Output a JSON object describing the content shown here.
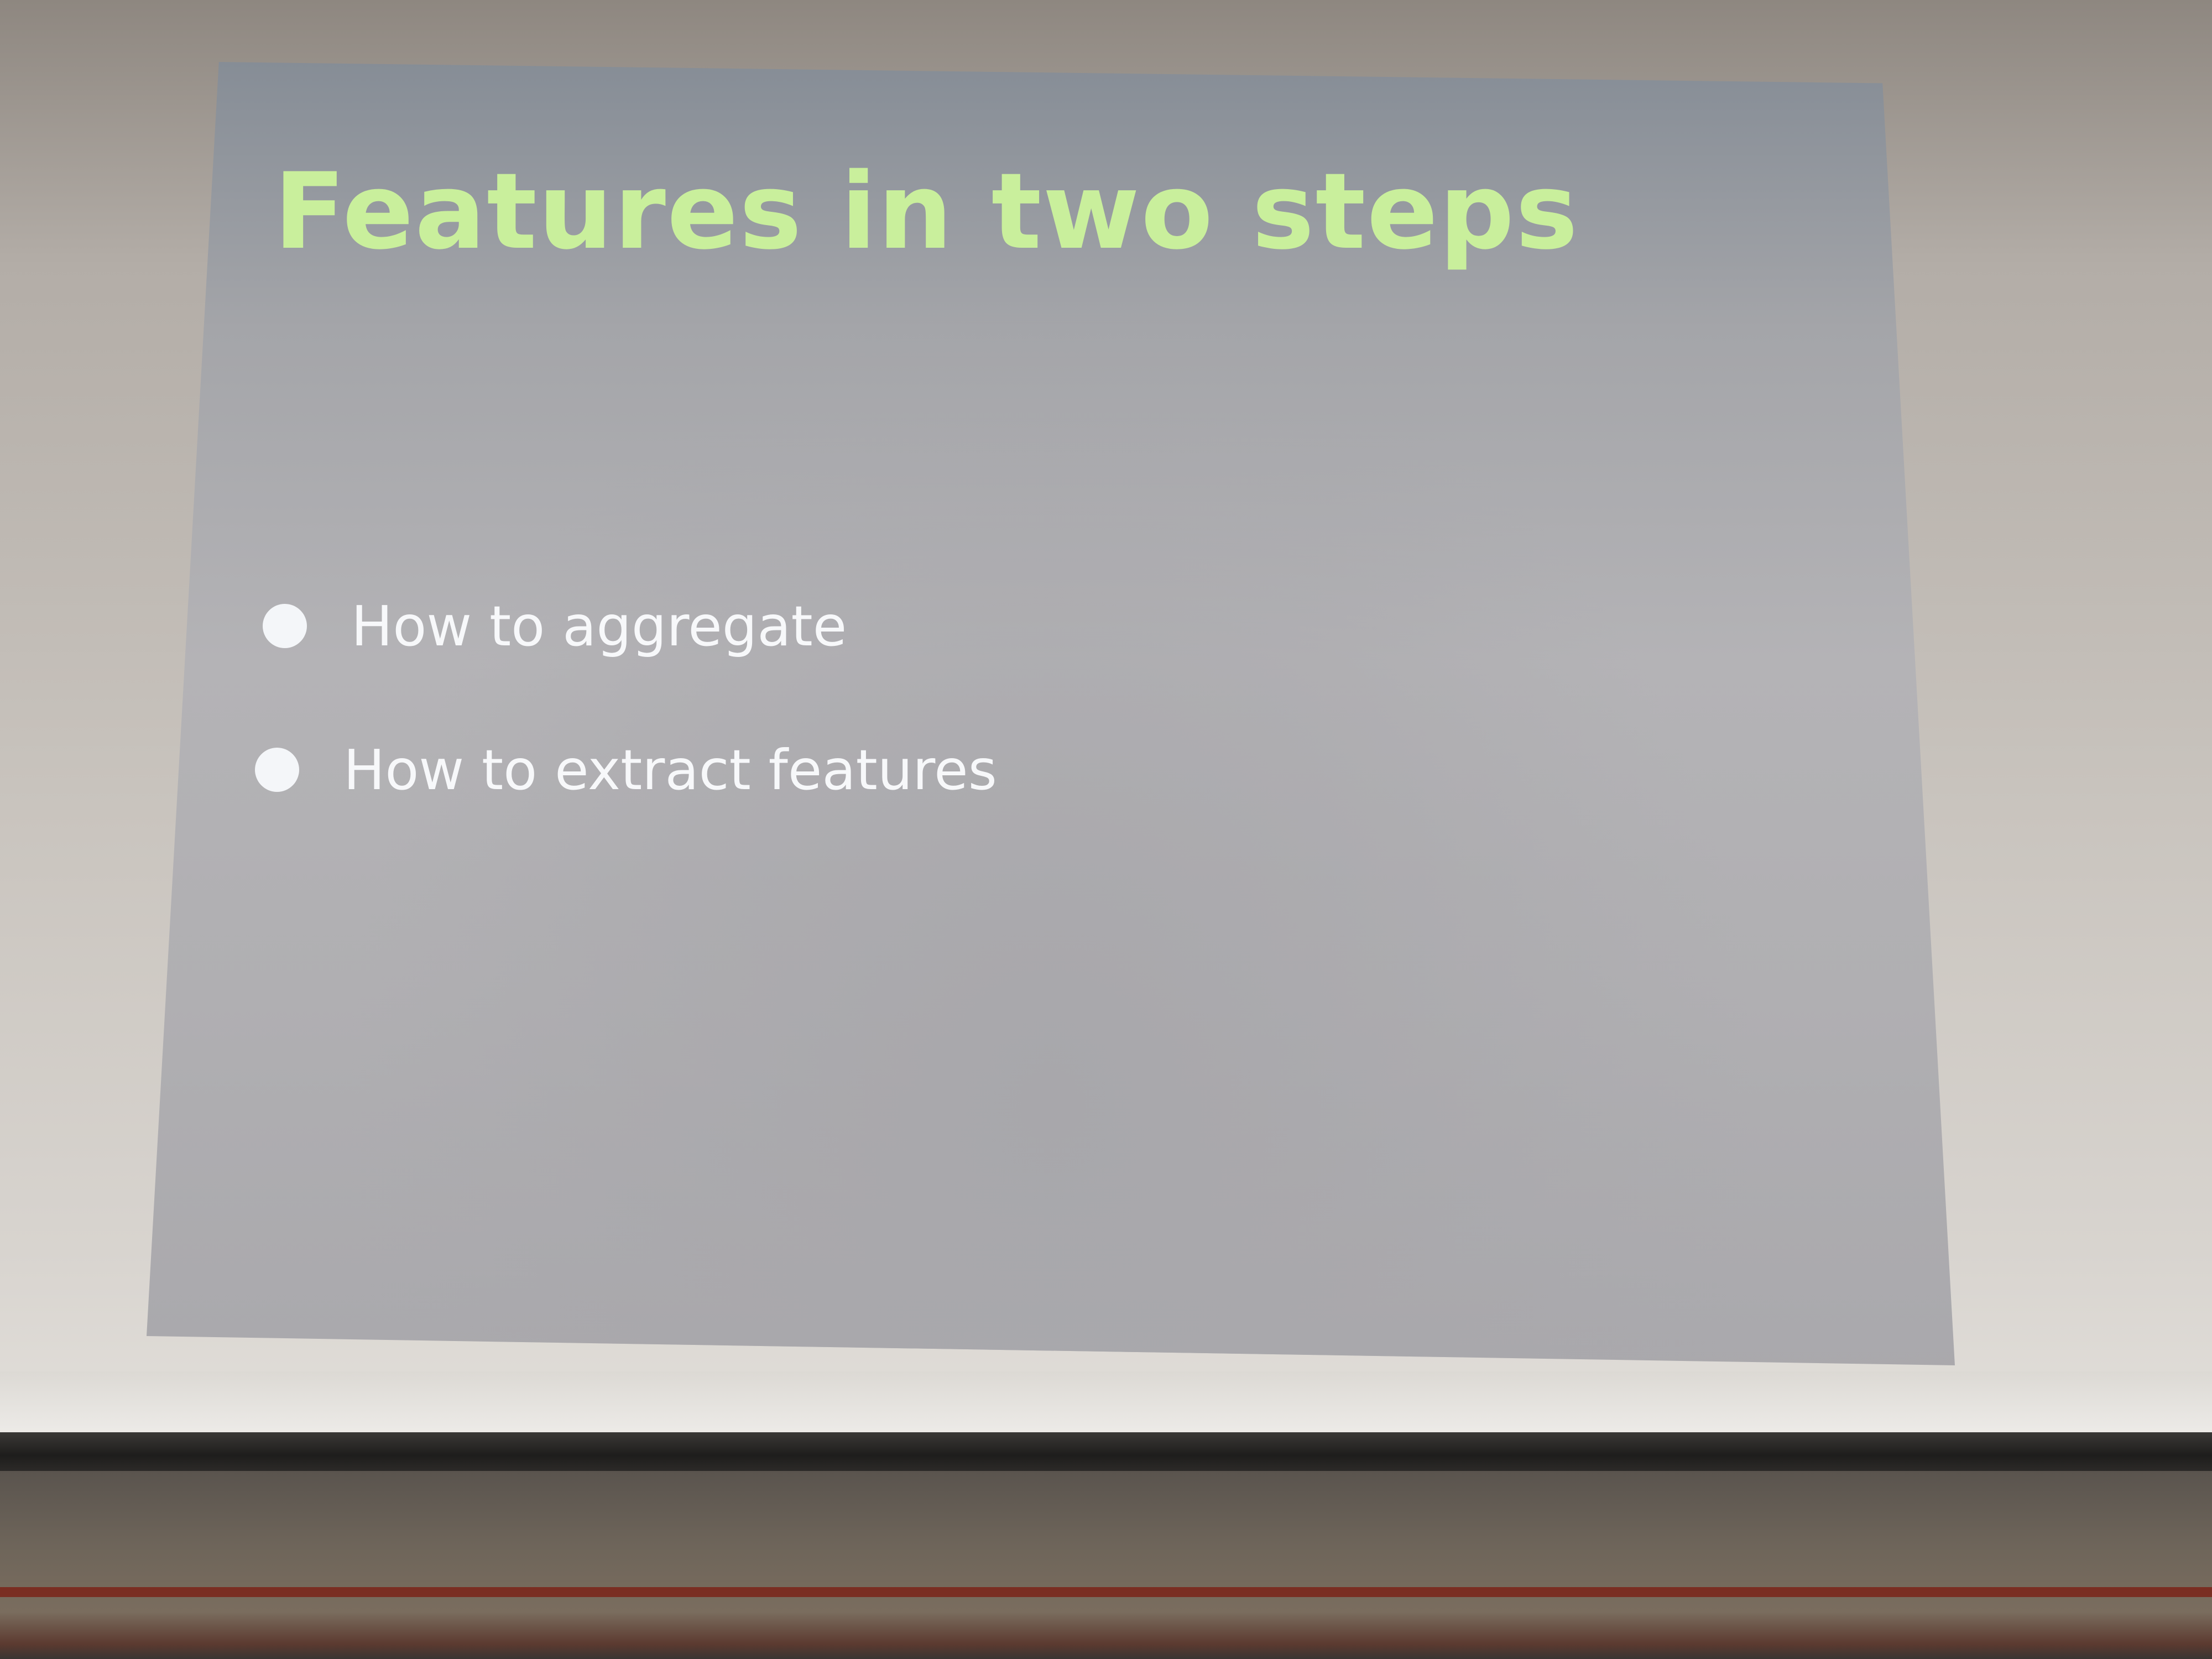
{
  "slide": {
    "title": "Features in two steps",
    "bullets": [
      "How to aggregate",
      "How to extract features"
    ]
  },
  "colors": {
    "title": "#c9ef9c",
    "bullet_text": "#f7f8fa",
    "slide_background": "#b0afb2"
  }
}
